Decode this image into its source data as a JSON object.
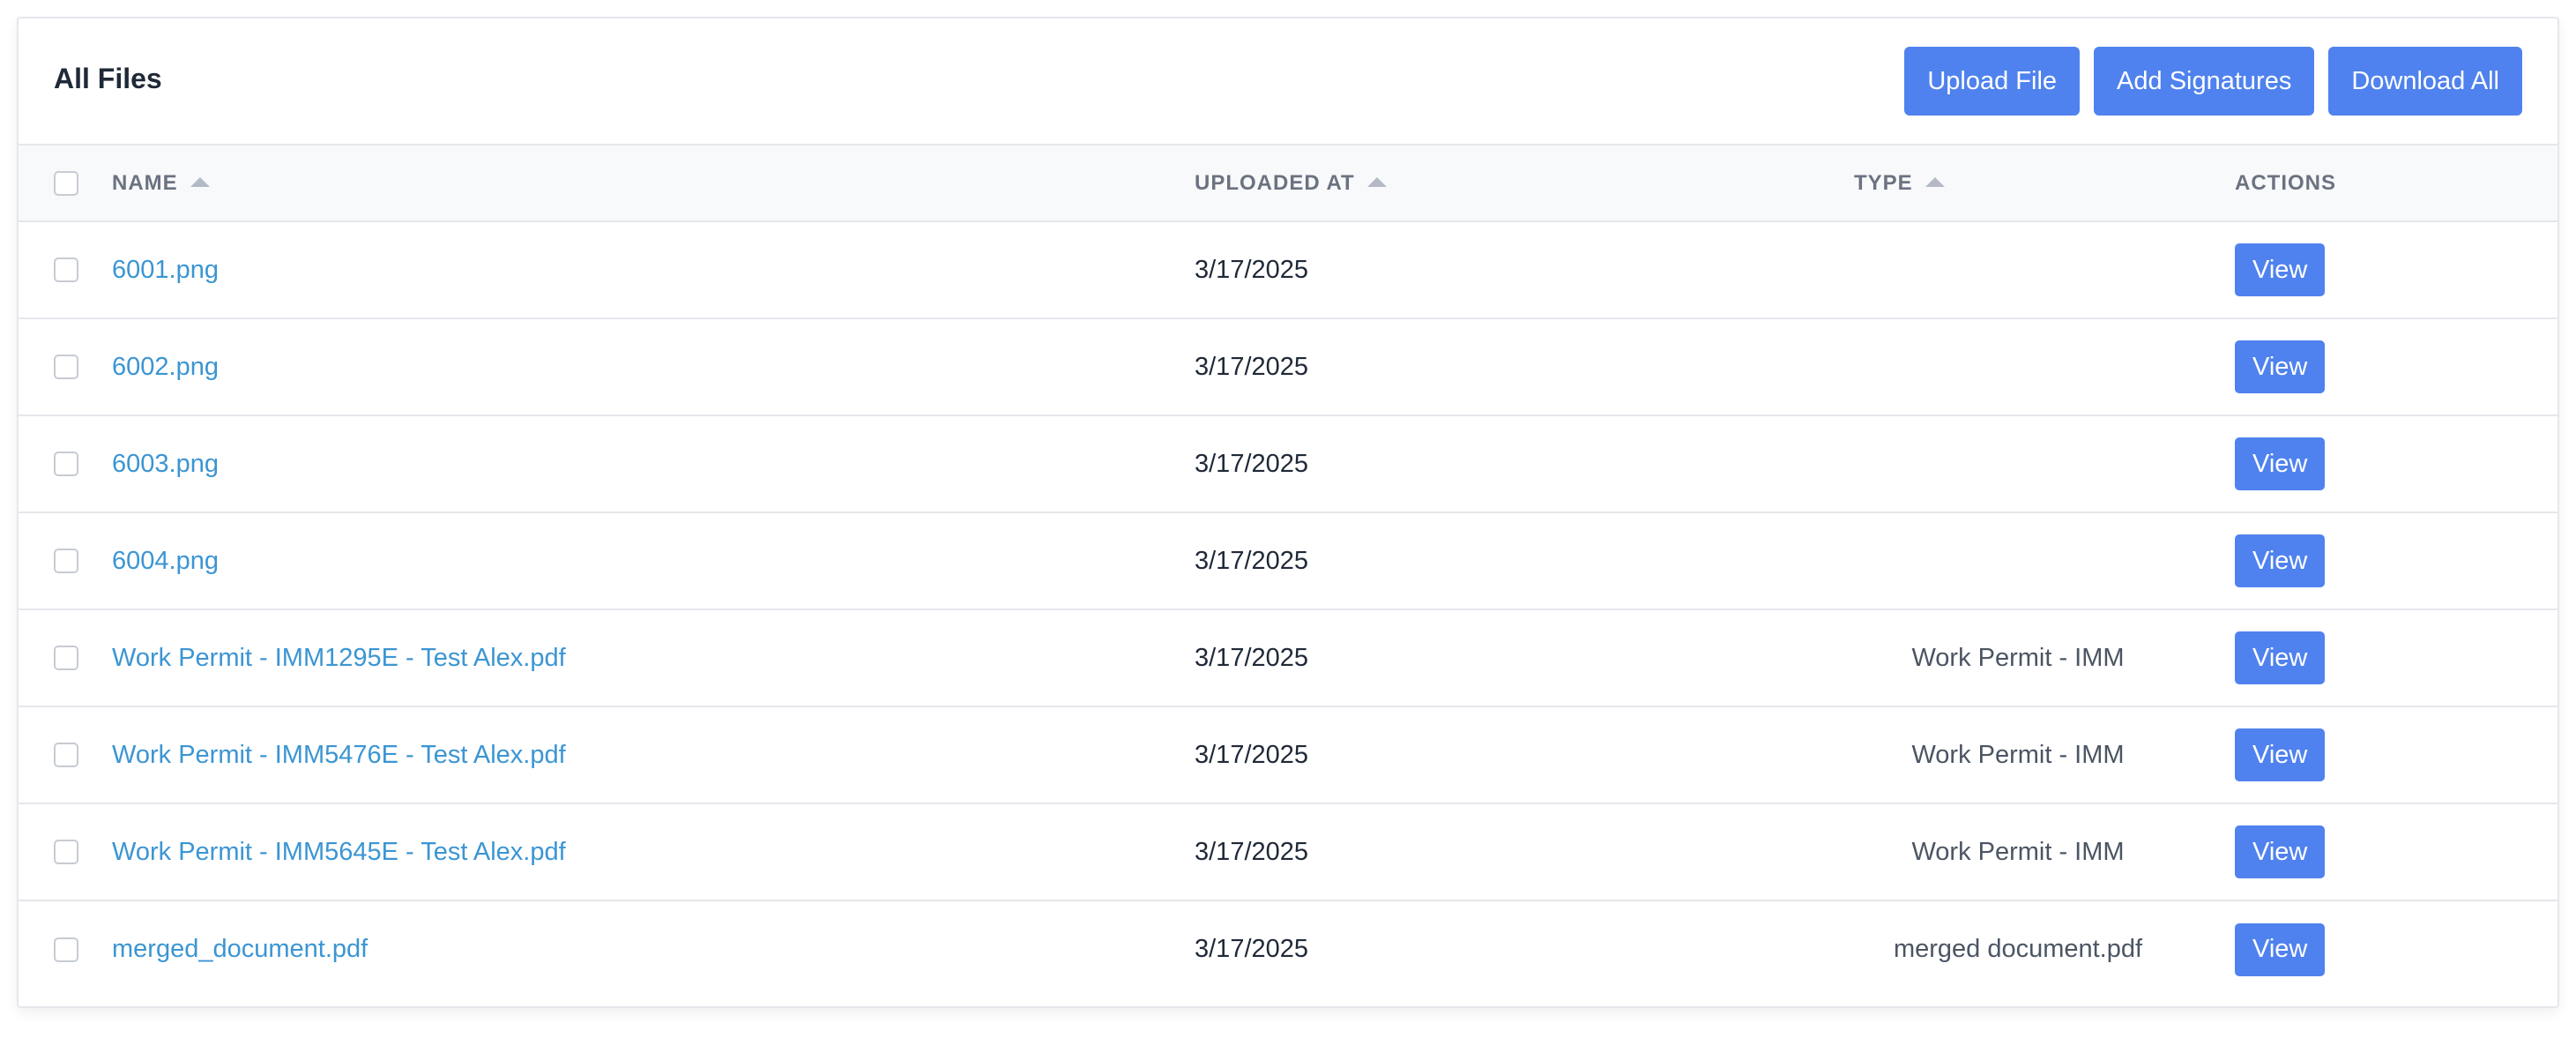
{
  "header": {
    "title": "All Files",
    "buttons": {
      "upload": "Upload File",
      "signatures": "Add Signatures",
      "download_all": "Download All"
    }
  },
  "table": {
    "columns": {
      "name": "NAME",
      "uploaded_at": "UPLOADED AT",
      "type": "TYPE",
      "actions": "ACTIONS"
    },
    "rows": [
      {
        "name": "6001.png",
        "uploaded_at": "3/17/2025",
        "type": "",
        "action": "View"
      },
      {
        "name": "6002.png",
        "uploaded_at": "3/17/2025",
        "type": "",
        "action": "View"
      },
      {
        "name": "6003.png",
        "uploaded_at": "3/17/2025",
        "type": "",
        "action": "View"
      },
      {
        "name": "6004.png",
        "uploaded_at": "3/17/2025",
        "type": "",
        "action": "View"
      },
      {
        "name": "Work Permit - IMM1295E - Test Alex.pdf",
        "uploaded_at": "3/17/2025",
        "type": "Work Permit - IMM",
        "action": "View"
      },
      {
        "name": "Work Permit - IMM5476E - Test Alex.pdf",
        "uploaded_at": "3/17/2025",
        "type": "Work Permit - IMM",
        "action": "View"
      },
      {
        "name": "Work Permit - IMM5645E - Test Alex.pdf",
        "uploaded_at": "3/17/2025",
        "type": "Work Permit - IMM",
        "action": "View"
      },
      {
        "name": "merged_document.pdf",
        "uploaded_at": "3/17/2025",
        "type": "merged document.pdf",
        "action": "View"
      }
    ]
  },
  "colors": {
    "primary": "#4f82ee",
    "link": "#3b95d3",
    "header_bg": "#f8f9fb",
    "border": "#e5e7eb"
  },
  "icons": {
    "sort": "sort-asc-icon",
    "checkbox": "checkbox-unchecked"
  }
}
